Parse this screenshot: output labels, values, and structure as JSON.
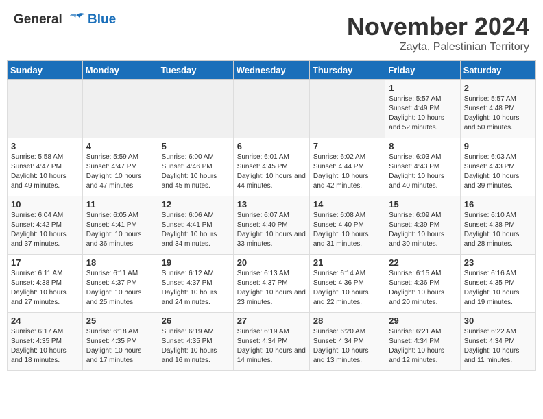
{
  "header": {
    "logo_line1": "General",
    "logo_line2": "Blue",
    "month": "November 2024",
    "location": "Zayta, Palestinian Territory"
  },
  "days_of_week": [
    "Sunday",
    "Monday",
    "Tuesday",
    "Wednesday",
    "Thursday",
    "Friday",
    "Saturday"
  ],
  "weeks": [
    [
      {
        "day": "",
        "empty": true
      },
      {
        "day": "",
        "empty": true
      },
      {
        "day": "",
        "empty": true
      },
      {
        "day": "",
        "empty": true
      },
      {
        "day": "",
        "empty": true
      },
      {
        "day": "1",
        "sunrise": "5:57 AM",
        "sunset": "4:49 PM",
        "daylight": "10 hours and 52 minutes."
      },
      {
        "day": "2",
        "sunrise": "5:57 AM",
        "sunset": "4:48 PM",
        "daylight": "10 hours and 50 minutes."
      }
    ],
    [
      {
        "day": "3",
        "sunrise": "5:58 AM",
        "sunset": "4:47 PM",
        "daylight": "10 hours and 49 minutes."
      },
      {
        "day": "4",
        "sunrise": "5:59 AM",
        "sunset": "4:47 PM",
        "daylight": "10 hours and 47 minutes."
      },
      {
        "day": "5",
        "sunrise": "6:00 AM",
        "sunset": "4:46 PM",
        "daylight": "10 hours and 45 minutes."
      },
      {
        "day": "6",
        "sunrise": "6:01 AM",
        "sunset": "4:45 PM",
        "daylight": "10 hours and 44 minutes."
      },
      {
        "day": "7",
        "sunrise": "6:02 AM",
        "sunset": "4:44 PM",
        "daylight": "10 hours and 42 minutes."
      },
      {
        "day": "8",
        "sunrise": "6:03 AM",
        "sunset": "4:43 PM",
        "daylight": "10 hours and 40 minutes."
      },
      {
        "day": "9",
        "sunrise": "6:03 AM",
        "sunset": "4:43 PM",
        "daylight": "10 hours and 39 minutes."
      }
    ],
    [
      {
        "day": "10",
        "sunrise": "6:04 AM",
        "sunset": "4:42 PM",
        "daylight": "10 hours and 37 minutes."
      },
      {
        "day": "11",
        "sunrise": "6:05 AM",
        "sunset": "4:41 PM",
        "daylight": "10 hours and 36 minutes."
      },
      {
        "day": "12",
        "sunrise": "6:06 AM",
        "sunset": "4:41 PM",
        "daylight": "10 hours and 34 minutes."
      },
      {
        "day": "13",
        "sunrise": "6:07 AM",
        "sunset": "4:40 PM",
        "daylight": "10 hours and 33 minutes."
      },
      {
        "day": "14",
        "sunrise": "6:08 AM",
        "sunset": "4:40 PM",
        "daylight": "10 hours and 31 minutes."
      },
      {
        "day": "15",
        "sunrise": "6:09 AM",
        "sunset": "4:39 PM",
        "daylight": "10 hours and 30 minutes."
      },
      {
        "day": "16",
        "sunrise": "6:10 AM",
        "sunset": "4:38 PM",
        "daylight": "10 hours and 28 minutes."
      }
    ],
    [
      {
        "day": "17",
        "sunrise": "6:11 AM",
        "sunset": "4:38 PM",
        "daylight": "10 hours and 27 minutes."
      },
      {
        "day": "18",
        "sunrise": "6:11 AM",
        "sunset": "4:37 PM",
        "daylight": "10 hours and 25 minutes."
      },
      {
        "day": "19",
        "sunrise": "6:12 AM",
        "sunset": "4:37 PM",
        "daylight": "10 hours and 24 minutes."
      },
      {
        "day": "20",
        "sunrise": "6:13 AM",
        "sunset": "4:37 PM",
        "daylight": "10 hours and 23 minutes."
      },
      {
        "day": "21",
        "sunrise": "6:14 AM",
        "sunset": "4:36 PM",
        "daylight": "10 hours and 22 minutes."
      },
      {
        "day": "22",
        "sunrise": "6:15 AM",
        "sunset": "4:36 PM",
        "daylight": "10 hours and 20 minutes."
      },
      {
        "day": "23",
        "sunrise": "6:16 AM",
        "sunset": "4:35 PM",
        "daylight": "10 hours and 19 minutes."
      }
    ],
    [
      {
        "day": "24",
        "sunrise": "6:17 AM",
        "sunset": "4:35 PM",
        "daylight": "10 hours and 18 minutes."
      },
      {
        "day": "25",
        "sunrise": "6:18 AM",
        "sunset": "4:35 PM",
        "daylight": "10 hours and 17 minutes."
      },
      {
        "day": "26",
        "sunrise": "6:19 AM",
        "sunset": "4:35 PM",
        "daylight": "10 hours and 16 minutes."
      },
      {
        "day": "27",
        "sunrise": "6:19 AM",
        "sunset": "4:34 PM",
        "daylight": "10 hours and 14 minutes."
      },
      {
        "day": "28",
        "sunrise": "6:20 AM",
        "sunset": "4:34 PM",
        "daylight": "10 hours and 13 minutes."
      },
      {
        "day": "29",
        "sunrise": "6:21 AM",
        "sunset": "4:34 PM",
        "daylight": "10 hours and 12 minutes."
      },
      {
        "day": "30",
        "sunrise": "6:22 AM",
        "sunset": "4:34 PM",
        "daylight": "10 hours and 11 minutes."
      }
    ]
  ]
}
